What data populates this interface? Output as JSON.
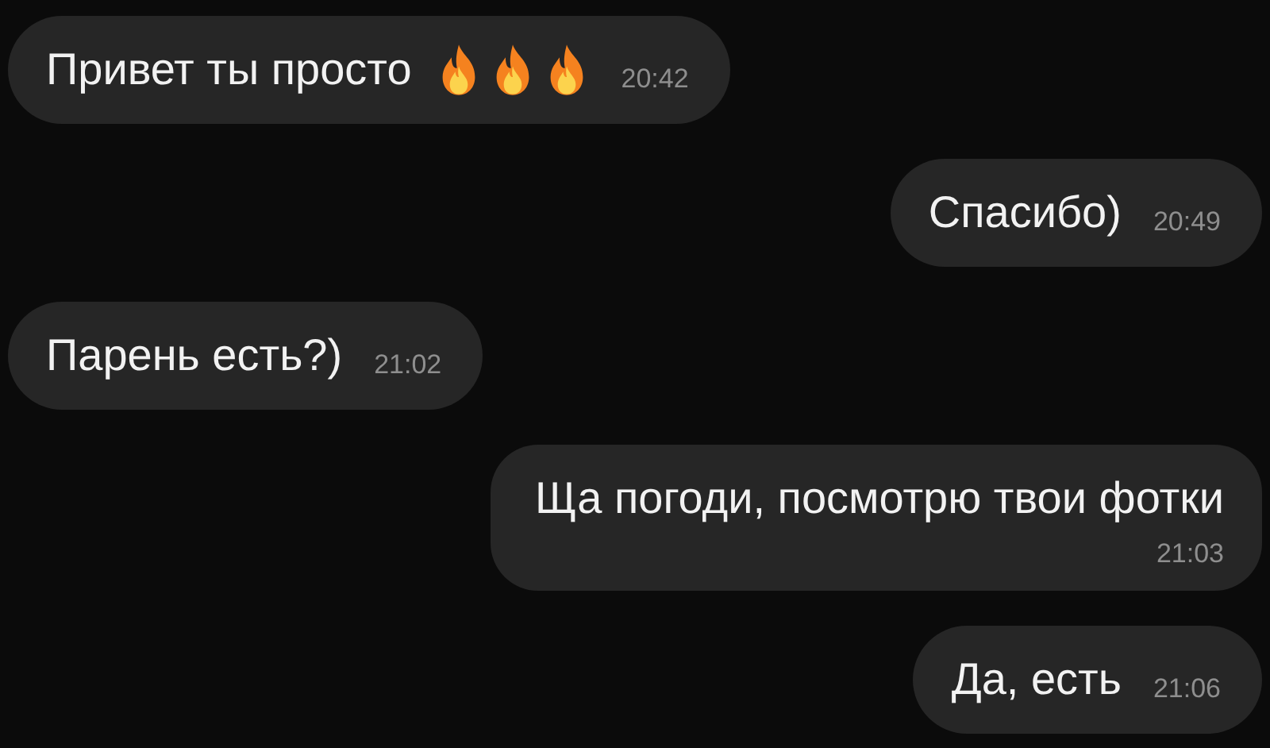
{
  "messages": [
    {
      "kind": "incoming",
      "text": "Привет ты просто",
      "icons": [
        {
          "kind": "fire"
        },
        {
          "kind": "fire"
        },
        {
          "kind": "fire"
        }
      ],
      "time": "20:42",
      "time_below": false
    },
    {
      "kind": "outgoing",
      "text": "Спасибо)",
      "time": "20:49",
      "time_below": false
    },
    {
      "kind": "incoming",
      "text": "Парень есть?)",
      "time": "21:02",
      "time_below": false
    },
    {
      "kind": "outgoing",
      "text": "Ща погоди, посмотрю твои фотки",
      "time": "21:03",
      "time_below": true
    },
    {
      "kind": "outgoing",
      "text": "Да, есть",
      "time": "21:06",
      "time_below": false
    }
  ]
}
